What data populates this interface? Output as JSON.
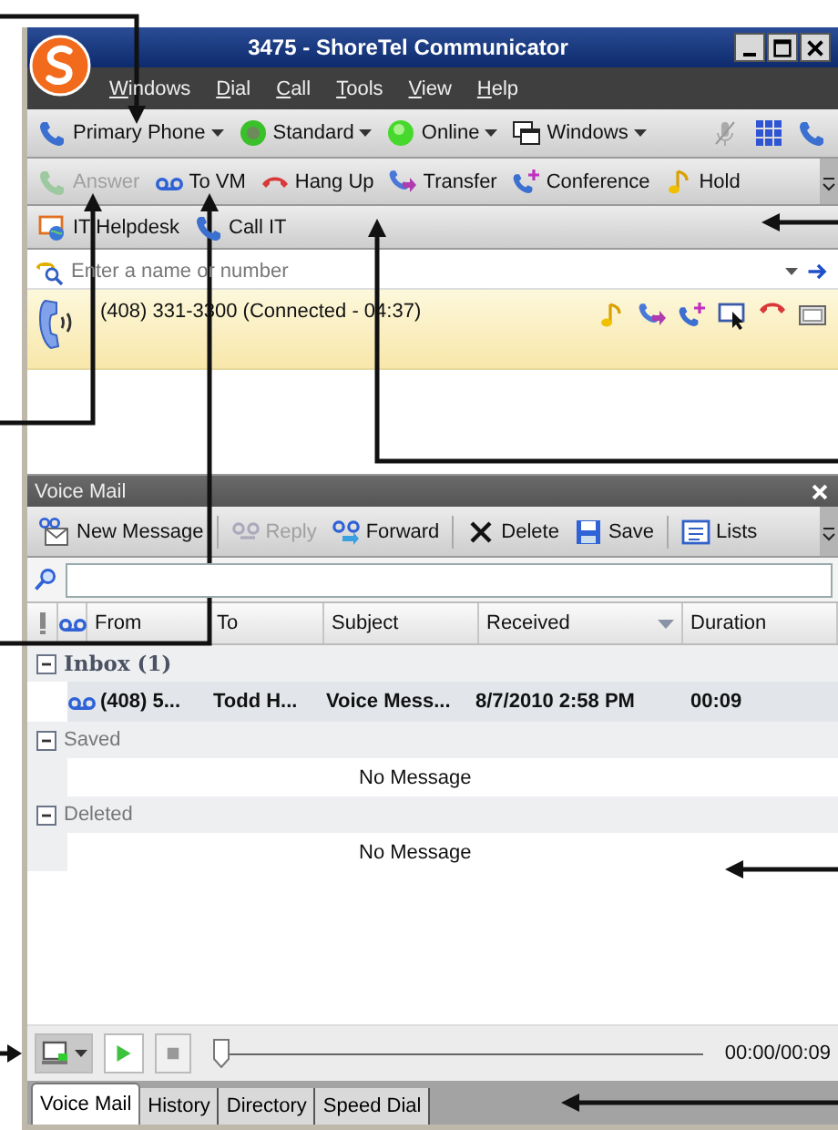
{
  "window": {
    "title": "3475 - ShoreTel Communicator"
  },
  "menu": [
    "Windows",
    "Dial",
    "Call",
    "Tools",
    "View",
    "Help"
  ],
  "status_toolbar": [
    {
      "label": "Primary Phone"
    },
    {
      "label": "Standard"
    },
    {
      "label": "Online"
    },
    {
      "label": "Windows"
    }
  ],
  "call_toolbar": [
    {
      "label": "Answer",
      "disabled": true
    },
    {
      "label": "To VM",
      "disabled": false
    },
    {
      "label": "Hang Up",
      "disabled": false
    },
    {
      "label": "Transfer",
      "disabled": false
    },
    {
      "label": "Conference",
      "disabled": false
    },
    {
      "label": "Hold",
      "disabled": false
    }
  ],
  "quick_dial": [
    "IT Helpdesk",
    "Call IT"
  ],
  "dial_field": {
    "placeholder": "Enter a name or number"
  },
  "active_call": {
    "text": "(408) 331-3300 (Connected - 04:37)"
  },
  "voice_mail": {
    "title": "Voice Mail",
    "toolbar": [
      {
        "label": "New Message",
        "disabled": false
      },
      {
        "label": "Reply",
        "disabled": true
      },
      {
        "label": "Forward",
        "disabled": false
      },
      {
        "label": "Delete",
        "disabled": false
      },
      {
        "label": "Save",
        "disabled": false
      },
      {
        "label": "Lists",
        "disabled": false
      }
    ],
    "columns": [
      {
        "label": "From",
        "sorted": false
      },
      {
        "label": "To",
        "sorted": false
      },
      {
        "label": "Subject",
        "sorted": false
      },
      {
        "label": "Received",
        "sorted": true
      },
      {
        "label": "Duration",
        "sorted": false
      }
    ],
    "groups": [
      {
        "label": "Inbox (1)",
        "expanded": true,
        "messages": [
          {
            "from": "(408) 5...",
            "to": "Todd H...",
            "subject": "Voice Mess...",
            "received": "8/7/2010 2:58 PM",
            "duration": "00:09",
            "unread": true
          }
        ]
      },
      {
        "label": "Saved",
        "expanded": true,
        "empty_text": "No Message"
      },
      {
        "label": "Deleted",
        "expanded": true,
        "empty_text": "No Message"
      }
    ],
    "player": {
      "time": "00:00/00:09",
      "level": 0
    },
    "tabs": [
      {
        "label": "Voice Mail",
        "selected": true
      },
      {
        "label": "History",
        "selected": false
      },
      {
        "label": "Directory",
        "selected": false
      },
      {
        "label": "Speed Dial",
        "selected": false
      }
    ]
  }
}
